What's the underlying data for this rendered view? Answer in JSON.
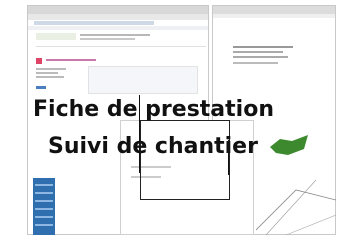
{
  "overlay": {
    "title_line1": "Fiche de prestation",
    "title_line2": "Suivi de chantier"
  },
  "colors": {
    "sidebar_blue": "#2f6fb0",
    "map_green": "#3d8a2e",
    "title_text": "#111111"
  }
}
